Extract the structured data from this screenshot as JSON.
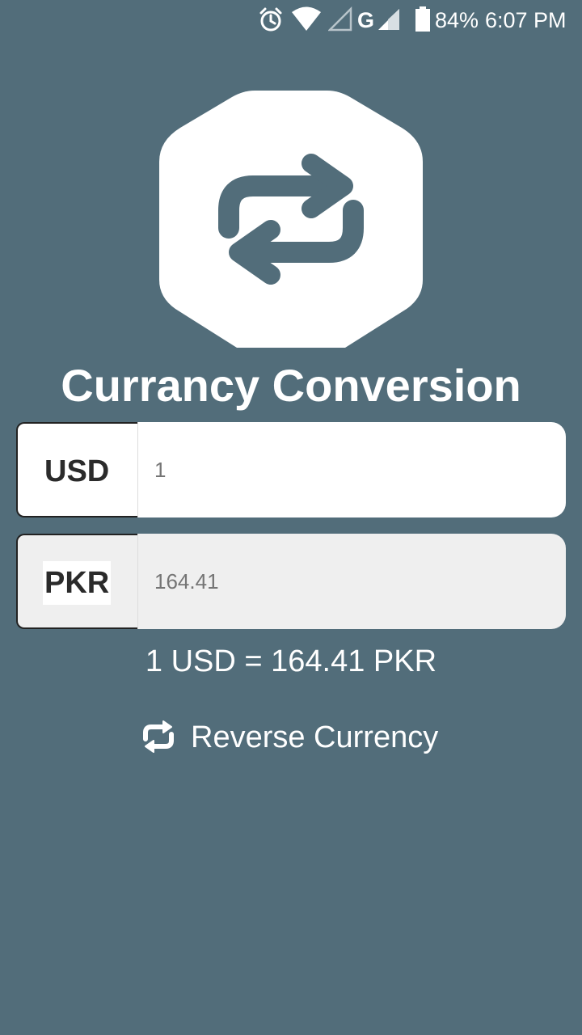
{
  "status_bar": {
    "battery": "84%",
    "time": "6:07 PM",
    "network": "G"
  },
  "title": "Currancy Conversion",
  "from": {
    "code": "USD",
    "value": "1"
  },
  "to": {
    "code": "PKR",
    "value": "164.41"
  },
  "rate_text": "1 USD = 164.41 PKR",
  "reverse_label": "Reverse Currency",
  "icons": {
    "logo": "swap-arrows-icon",
    "reverse": "repeat-icon"
  },
  "colors": {
    "background": "#526d7a",
    "text": "#ffffff",
    "input_bg": "#ffffff",
    "readonly_bg": "#efefef"
  }
}
